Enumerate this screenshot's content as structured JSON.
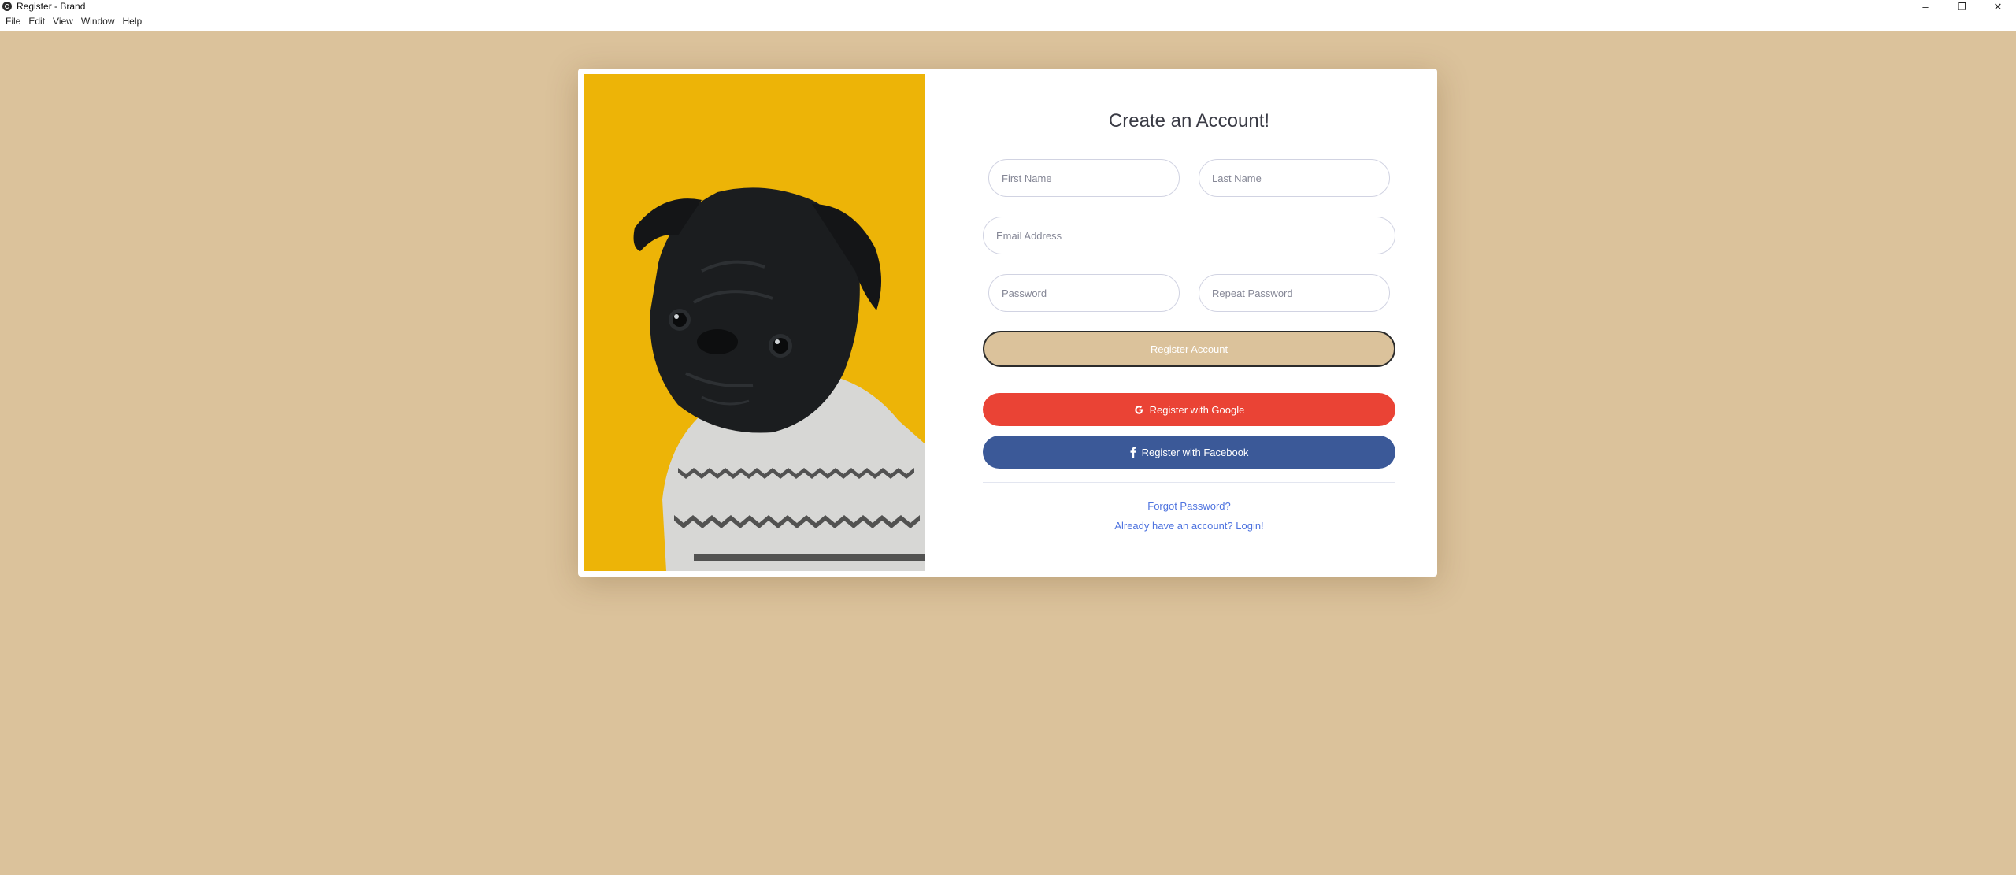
{
  "window": {
    "title": "Register - Brand",
    "controls": {
      "minimize": "–",
      "restore": "❐",
      "close": "✕"
    }
  },
  "menu": [
    "File",
    "Edit",
    "View",
    "Window",
    "Help"
  ],
  "colors": {
    "background": "#dbc29b",
    "photo_background": "#edb407",
    "google": "#ea4335",
    "facebook": "#3b5998",
    "link": "#4e73df"
  },
  "form": {
    "heading": "Create an Account!",
    "first_name_placeholder": "First Name",
    "last_name_placeholder": "Last Name",
    "email_placeholder": "Email Address",
    "password_placeholder": "Password",
    "repeat_password_placeholder": "Repeat Password",
    "register_button": "Register Account",
    "google_button": "Register with Google",
    "google_icon": "google-icon",
    "facebook_button": "Register with Facebook",
    "facebook_icon": "facebook-icon",
    "forgot_password": "Forgot Password?",
    "login_link": "Already have an account? Login!"
  },
  "image": {
    "subject": "pug-in-sweater-photo"
  }
}
